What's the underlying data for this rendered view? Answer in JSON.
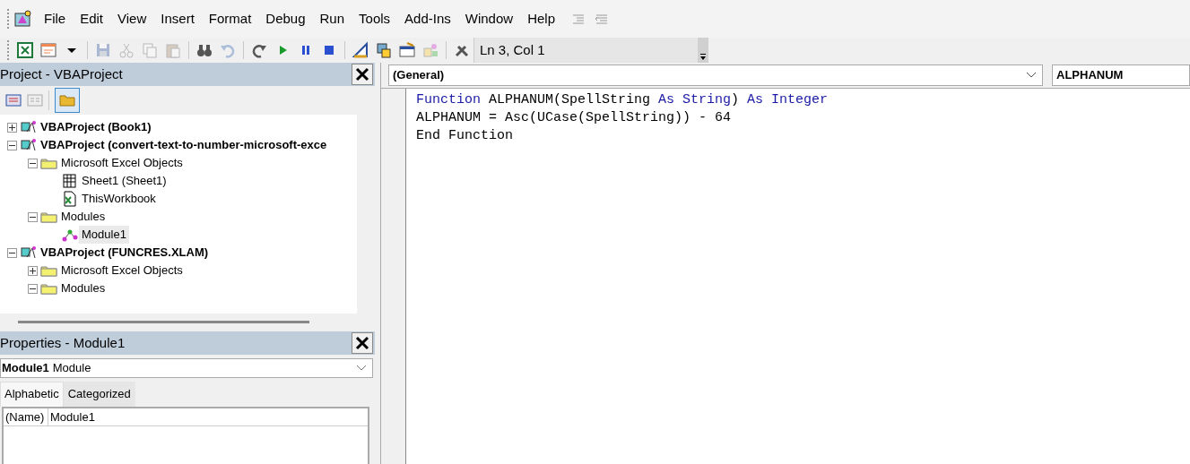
{
  "menu": [
    {
      "label": "File"
    },
    {
      "label": "Edit"
    },
    {
      "label": "View"
    },
    {
      "label": "Insert"
    },
    {
      "label": "Format"
    },
    {
      "label": "Debug"
    },
    {
      "label": "Run"
    },
    {
      "label": "Tools"
    },
    {
      "label": "Add-Ins"
    },
    {
      "label": "Window"
    },
    {
      "label": "Help"
    }
  ],
  "toolbar": {
    "buttons": [
      {
        "disabled": false
      },
      {
        "disabled": false
      },
      {
        "disabled": false
      },
      {
        "disabled": true
      },
      {
        "disabled": true
      },
      {
        "disabled": true
      },
      {
        "disabled": true
      },
      {
        "disabled": false
      },
      {
        "disabled": true
      },
      {
        "disabled": false
      },
      {
        "disabled": false
      },
      {
        "disabled": false
      },
      {
        "disabled": false
      },
      {
        "disabled": false
      },
      {
        "disabled": false
      },
      {
        "disabled": false
      },
      {
        "disabled": true
      },
      {
        "disabled": false
      }
    ],
    "position": "Ln 3, Col 1"
  },
  "project": {
    "title": "Project - VBAProject",
    "tree": [
      {
        "label": "VBAProject (Book1)",
        "kind": "project",
        "expanded": false,
        "selected": false
      },
      {
        "label": "VBAProject (convert-text-to-number-microsoft-exce",
        "kind": "project",
        "expanded": true,
        "selected": false,
        "children": [
          {
            "label": "Microsoft Excel Objects",
            "kind": "folder",
            "expanded": true,
            "selected": false,
            "children": [
              {
                "label": "Sheet1 (Sheet1)",
                "kind": "sheet",
                "selected": false
              },
              {
                "label": "ThisWorkbook",
                "kind": "workbook",
                "selected": false
              }
            ]
          },
          {
            "label": "Modules",
            "kind": "folder",
            "expanded": true,
            "selected": false,
            "children": [
              {
                "label": "Module1",
                "kind": "module",
                "selected": true
              }
            ]
          }
        ]
      },
      {
        "label": "VBAProject (FUNCRES.XLAM)",
        "kind": "project",
        "expanded": true,
        "selected": false,
        "children": [
          {
            "label": "Microsoft Excel Objects",
            "kind": "folder",
            "expanded": false,
            "selected": false
          },
          {
            "label": "Modules",
            "kind": "folder",
            "expanded": true,
            "selected": false
          }
        ]
      }
    ]
  },
  "properties": {
    "title": "Properties - Module1",
    "object": "Module1",
    "object_type": "Module",
    "tabs": [
      {
        "label": "Alphabetic",
        "selected": true
      },
      {
        "label": "Categorized",
        "selected": false
      }
    ],
    "rows": [
      {
        "name": "(Name)",
        "value": "Module1"
      }
    ]
  },
  "code": {
    "object": "(General)",
    "procedure": "ALPHANUM",
    "lines": [
      [
        {
          "kind": "keyword",
          "text": "Function"
        },
        {
          "kind": "plain",
          "text": " ALPHANUM(SpellString "
        },
        {
          "kind": "keyword",
          "text": "As String"
        },
        {
          "kind": "plain",
          "text": ") "
        },
        {
          "kind": "keyword",
          "text": "As Integer"
        }
      ],
      [
        {
          "kind": "plain",
          "text": "ALPHANUM = Asc(UCase(SpellString)) - 64"
        }
      ],
      [
        {
          "kind": "plain",
          "text": "End Function"
        }
      ]
    ]
  }
}
